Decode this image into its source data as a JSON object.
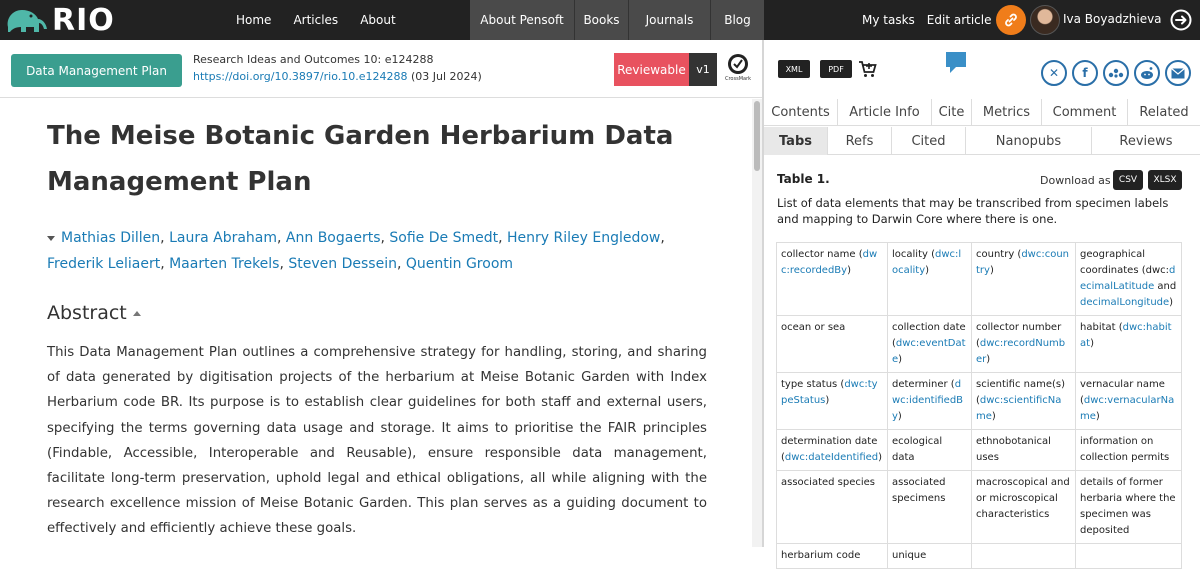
{
  "brand": {
    "name": "RIO"
  },
  "nav": {
    "left": [
      "Home",
      "Articles",
      "About"
    ],
    "middle": [
      "About Pensoft",
      "Books",
      "Journals",
      "Blog"
    ],
    "right": [
      "My tasks",
      "Edit article"
    ]
  },
  "user": {
    "name": "Iva Boyadzhieva"
  },
  "article_header": {
    "type_button": "Data Management Plan",
    "journal": "Research Ideas and Outcomes 10: e124288",
    "doi": "https://doi.org/10.3897/rio.10.e124288",
    "date": "(03 Jul 2024)",
    "reviewable": "Reviewable",
    "version": "v1",
    "crossmark": "CrossMark"
  },
  "article": {
    "title": "The Meise Botanic Garden Herbarium Data Management Plan",
    "authors": [
      "Mathias Dillen",
      "Laura Abraham",
      "Ann Bogaerts",
      "Sofie De Smedt",
      "Henry Riley Engledow",
      "Frederik Leliaert",
      "Maarten Trekels",
      "Steven Dessein",
      "Quentin Groom"
    ],
    "abstract_heading": "Abstract",
    "abstract": "This Data Management Plan outlines a comprehensive strategy for handling, storing, and sharing of data generated by digitisation projects of the herbarium at Meise Botanic Garden with Index Herbarium code BR. Its purpose is to establish clear guidelines for both staff and external users, specifying the terms governing data usage and storage. It aims to prioritise the FAIR principles (Findable, Accessible, Interoperable and Reusable), ensure responsible data management, facilitate long-term preservation, uphold legal and ethical obligations, all while aligning with the research excellence mission of Meise Botanic Garden. This plan serves as a guiding document to effectively and efficiently achieve these goals."
  },
  "tools": {
    "xml": "XML",
    "pdf": "PDF"
  },
  "share_icons": [
    "x-icon",
    "facebook-icon",
    "mendeley-icon",
    "reddit-icon",
    "email-icon"
  ],
  "tabs_row1": [
    "Contents",
    "Article Info",
    "Cite",
    "Metrics",
    "Comment",
    "Related"
  ],
  "tabs_row2": [
    "Tabs",
    "Refs",
    "Cited",
    "Nanopubs",
    "Reviews"
  ],
  "table_panel": {
    "caption": "Table 1.",
    "download_label": "Download as",
    "csv": "CSV",
    "xlsx": "XLSX",
    "description": "List of data elements that may be transcribed from specimen labels and mapping to Darwin Core where there is one.",
    "rows": [
      [
        {
          "t": "collector name (",
          "l": "dwc:recordedBy",
          "a": ")"
        },
        {
          "t": "locality (",
          "l": "dwc:locality",
          "a": ")"
        },
        {
          "t": "country (",
          "l": "dwc:country",
          "a": ")"
        },
        {
          "t": "geographical coordinates (dwc:",
          "l": "decimalLatitude",
          "a": " and ",
          "l2": "decimalLongitude",
          "a2": ")"
        }
      ],
      [
        {
          "t": "ocean or sea"
        },
        {
          "t": "collection date (",
          "l": "dwc:eventDate",
          "a": ")"
        },
        {
          "t": "collector number (",
          "l": "dwc:recordNumber",
          "a": ")"
        },
        {
          "t": "habitat (",
          "l": "dwc:habitat",
          "a": ")"
        }
      ],
      [
        {
          "t": "type status (",
          "l": "dwc:typeStatus",
          "a": ")"
        },
        {
          "t": "determiner (",
          "l": "dwc:identifiedBy",
          "a": ")"
        },
        {
          "t": "scientific name(s) (",
          "l": "dwc:scientificName",
          "a": ")"
        },
        {
          "t": "vernacular name (",
          "l": "dwc:vernacularName",
          "a": ")"
        }
      ],
      [
        {
          "t": "determination date (",
          "l": "dwc:dateIdentified",
          "a": ")"
        },
        {
          "t": "ecological data"
        },
        {
          "t": "ethnobotanical uses"
        },
        {
          "t": "information on collection permits"
        }
      ],
      [
        {
          "t": "associated species"
        },
        {
          "t": "associated specimens"
        },
        {
          "t": "macroscopical and or microscopical characteristics"
        },
        {
          "t": "details of former herbaria where the specimen was deposited"
        }
      ],
      [
        {
          "t": "herbarium code"
        },
        {
          "t": "unique"
        },
        {
          "t": ""
        },
        {
          "t": ""
        }
      ]
    ]
  }
}
